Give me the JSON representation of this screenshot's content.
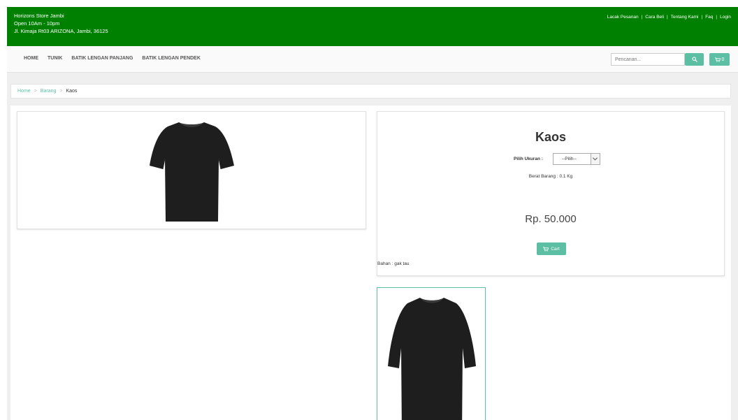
{
  "store": {
    "name": "Horizons Store Jambi",
    "hours": "Open 10Am - 10pm",
    "address": "Jl. Kimaja Rt03 ARIZONA, Jambi, 36125"
  },
  "top_links": [
    "Lacak Pesanan",
    "Cara Beli",
    "Tentang Kami",
    "Faq",
    "Login"
  ],
  "top_links_separator": "|",
  "nav": {
    "items": [
      "HOME",
      "TUNIK",
      "BATIK LENGAN PANJANG",
      "BATIK LENGAN PENDEK"
    ],
    "search_placeholder": "Pencarian...",
    "search_icon": "search-icon",
    "cart_icon": "shopping-cart-icon",
    "cart_count": "0"
  },
  "breadcrumb": {
    "items": [
      "Home",
      "Barang",
      "Kaos"
    ],
    "separator": ">"
  },
  "product": {
    "title": "Kaos",
    "size_label": "Pilih Ukuran :",
    "size_selected": "--Pilih--",
    "weight": "Berat Barang : 0.1 Kg",
    "price": "Rp. 50.000",
    "cart_button": "Cart",
    "material": "Bahan : gak tau",
    "image_icon": "black-tshirt-image",
    "thumbnail_icon": "black-tshirt-thumbnail"
  },
  "colors": {
    "topbar": "#008000",
    "accent": "#5cbfa4",
    "background": "#efefef",
    "shirt": "#1e1e1e"
  }
}
